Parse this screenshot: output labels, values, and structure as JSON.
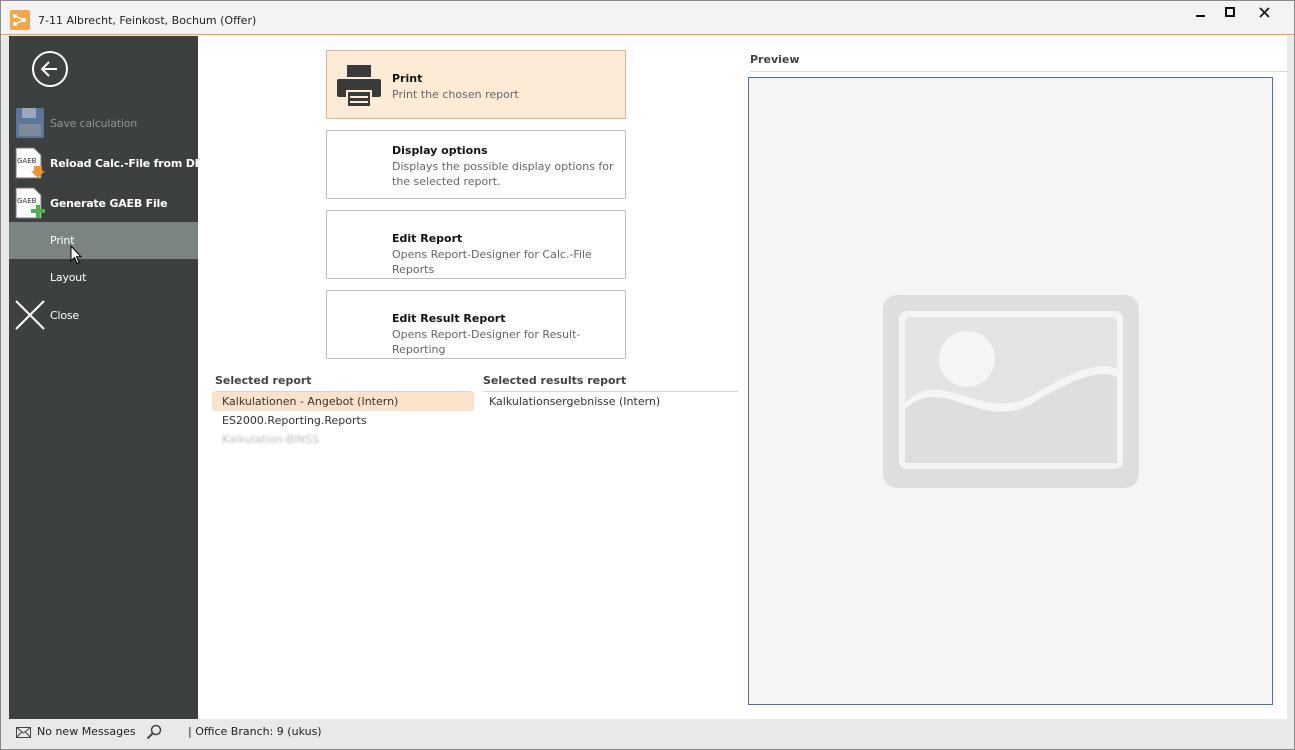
{
  "window": {
    "title": "7-11 Albrecht, Feinkost, Bochum (Offer)",
    "controls": {
      "minimize": "–",
      "maximize": "□",
      "close": "✕"
    }
  },
  "sidebar": {
    "back_icon": "back-arrow-icon",
    "items": [
      {
        "label": "Save calculation",
        "icon": "floppy-disk-icon",
        "state": "disabled"
      },
      {
        "label": "Reload Calc.-File from DB",
        "icon": "gaeb-download-icon",
        "state": "normal"
      },
      {
        "label": "Generate GAEB File",
        "icon": "gaeb-add-icon",
        "state": "normal"
      },
      {
        "label": "Print",
        "icon": "",
        "state": "active"
      },
      {
        "label": "Layout",
        "icon": "",
        "state": "normal"
      },
      {
        "label": "Close",
        "icon": "close-x-icon",
        "state": "normal"
      }
    ],
    "gaeb_icon_text": "GAEB"
  },
  "actions": [
    {
      "title": "Print",
      "description": "Print the chosen report",
      "icon": "printer-icon",
      "highlighted": true
    },
    {
      "title": "Display options",
      "description": "Displays the possible display options for the selected report.",
      "icon": "",
      "highlighted": false
    },
    {
      "title": "Edit Report",
      "description": "Opens Report-Designer for Calc.-File Reports",
      "icon": "",
      "highlighted": false
    },
    {
      "title": "Edit Result Report",
      "description": "Opens Report-Designer for Result-Reporting",
      "icon": "",
      "highlighted": false
    }
  ],
  "selected_report": {
    "header": "Selected report",
    "items": [
      {
        "label": "Kalkulationen - Angebot (Intern)",
        "selected": true
      },
      {
        "label": "ES2000.Reporting.Reports",
        "selected": false
      },
      {
        "label": "Kalkulation-BINSS",
        "selected": false
      }
    ]
  },
  "selected_results_report": {
    "header": "Selected results report",
    "items": [
      {
        "label": "Kalkulationsergebnisse (Intern)",
        "selected": false
      }
    ]
  },
  "preview": {
    "title": "Preview",
    "placeholder_icon": "image-placeholder-icon"
  },
  "statusbar": {
    "messages": "No new Messages",
    "office_branch": "| Office Branch:  9 (ukus)"
  },
  "colors": {
    "sidebar": "#3c4040",
    "accent": "#f3a64a",
    "highlight": "#fdebd6",
    "preview_border": "#4b6ea8"
  }
}
